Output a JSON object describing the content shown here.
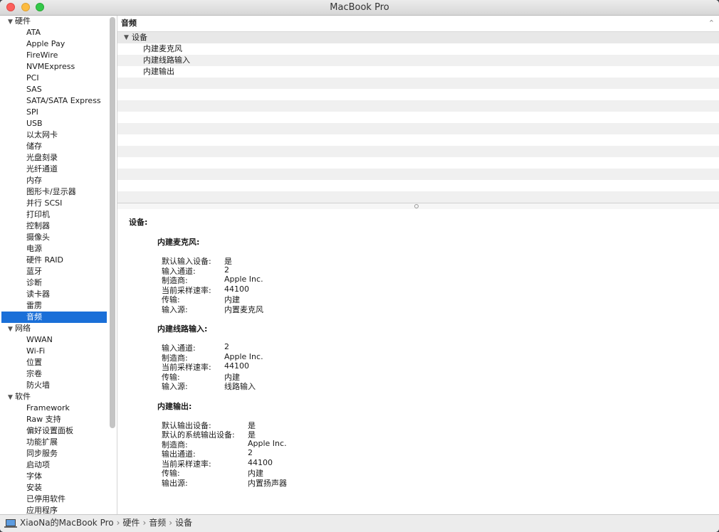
{
  "window": {
    "title": "MacBook Pro"
  },
  "sidebar": {
    "items": [
      {
        "type": "cat",
        "label": "硬件"
      },
      {
        "type": "item",
        "label": "ATA"
      },
      {
        "type": "item",
        "label": "Apple Pay"
      },
      {
        "type": "item",
        "label": "FireWire"
      },
      {
        "type": "item",
        "label": "NVMExpress"
      },
      {
        "type": "item",
        "label": "PCI"
      },
      {
        "type": "item",
        "label": "SAS"
      },
      {
        "type": "item",
        "label": "SATA/SATA Express"
      },
      {
        "type": "item",
        "label": "SPI"
      },
      {
        "type": "item",
        "label": "USB"
      },
      {
        "type": "item",
        "label": "以太网卡"
      },
      {
        "type": "item",
        "label": "储存"
      },
      {
        "type": "item",
        "label": "光盘刻录"
      },
      {
        "type": "item",
        "label": "光纤通道"
      },
      {
        "type": "item",
        "label": "内存"
      },
      {
        "type": "item",
        "label": "图形卡/显示器"
      },
      {
        "type": "item",
        "label": "并行 SCSI"
      },
      {
        "type": "item",
        "label": "打印机"
      },
      {
        "type": "item",
        "label": "控制器"
      },
      {
        "type": "item",
        "label": "摄像头"
      },
      {
        "type": "item",
        "label": "电源"
      },
      {
        "type": "item",
        "label": "硬件 RAID"
      },
      {
        "type": "item",
        "label": "蓝牙"
      },
      {
        "type": "item",
        "label": "诊断"
      },
      {
        "type": "item",
        "label": "读卡器"
      },
      {
        "type": "item",
        "label": "雷雳"
      },
      {
        "type": "item",
        "label": "音频",
        "selected": true
      },
      {
        "type": "cat",
        "label": "网络"
      },
      {
        "type": "item",
        "label": "WWAN"
      },
      {
        "type": "item",
        "label": "Wi-Fi"
      },
      {
        "type": "item",
        "label": "位置"
      },
      {
        "type": "item",
        "label": "宗卷"
      },
      {
        "type": "item",
        "label": "防火墙"
      },
      {
        "type": "cat",
        "label": "软件"
      },
      {
        "type": "item",
        "label": "Framework"
      },
      {
        "type": "item",
        "label": "Raw 支持"
      },
      {
        "type": "item",
        "label": "偏好设置面板"
      },
      {
        "type": "item",
        "label": "功能扩展"
      },
      {
        "type": "item",
        "label": "同步服务"
      },
      {
        "type": "item",
        "label": "启动项"
      },
      {
        "type": "item",
        "label": "字体"
      },
      {
        "type": "item",
        "label": "安装"
      },
      {
        "type": "item",
        "label": "已停用软件"
      },
      {
        "type": "item",
        "label": "应用程序"
      }
    ]
  },
  "list": {
    "header": "音频",
    "group": "设备",
    "rows": [
      "内建麦克风",
      "内建线路输入",
      "内建输出"
    ]
  },
  "detail": {
    "title": "设备:",
    "sections": [
      {
        "name": "内建麦克风:",
        "props": [
          [
            "默认输入设备:",
            "是"
          ],
          [
            "输入通道:",
            "2"
          ],
          [
            "制造商:",
            "Apple Inc."
          ],
          [
            "当前采样速率:",
            "44100"
          ],
          [
            "传输:",
            "内建"
          ],
          [
            "输入源:",
            "内置麦克风"
          ]
        ]
      },
      {
        "name": "内建线路输入:",
        "props": [
          [
            "输入通道:",
            "2"
          ],
          [
            "制造商:",
            "Apple Inc."
          ],
          [
            "当前采样速率:",
            "44100"
          ],
          [
            "传输:",
            "内建"
          ],
          [
            "输入源:",
            "线路输入"
          ]
        ]
      },
      {
        "name": "内建输出:",
        "props": [
          [
            "默认输出设备:",
            "是"
          ],
          [
            "默认的系统输出设备:",
            "是"
          ],
          [
            "制造商:",
            "Apple Inc."
          ],
          [
            "输出通道:",
            "2"
          ],
          [
            "当前采样速率:",
            "44100"
          ],
          [
            "传输:",
            "内建"
          ],
          [
            "输出源:",
            "内置扬声器"
          ]
        ]
      }
    ]
  },
  "statusbar": {
    "crumbs": [
      "XiaoNa的MacBook Pro",
      "硬件",
      "音频",
      "设备"
    ],
    "separator": "›"
  }
}
